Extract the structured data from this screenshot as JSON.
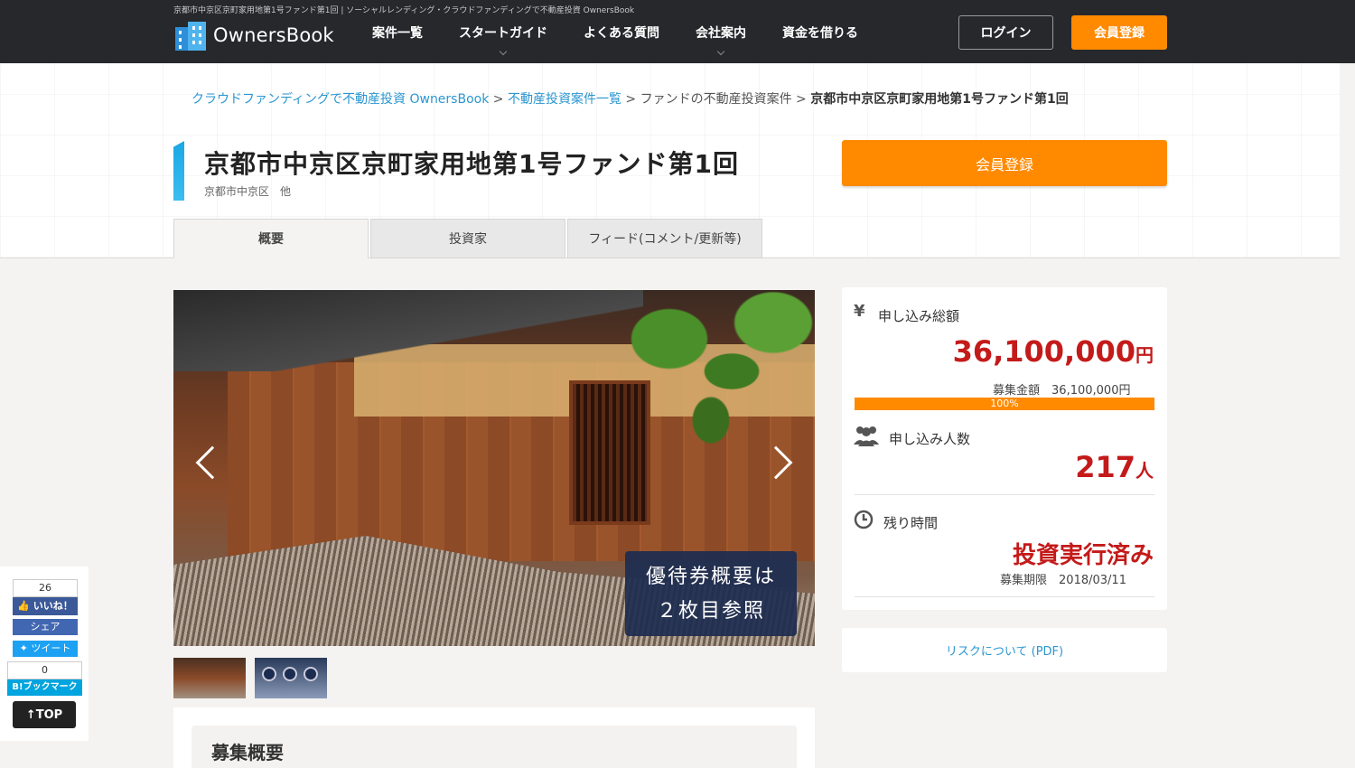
{
  "header": {
    "tagline": "京都市中京区京町家用地第1号ファンド第1回 | ソーシャルレンディング・クラウドファンディングで不動産投資 OwnersBook",
    "logo_text": "OwnersBook",
    "nav": [
      {
        "label": "案件一覧"
      },
      {
        "label": "スタートガイド"
      },
      {
        "label": "よくある質問"
      },
      {
        "label": "会社案内"
      },
      {
        "label": "資金を借りる"
      }
    ],
    "login_label": "ログイン",
    "register_label": "会員登録"
  },
  "breadcrumb": {
    "item1": "クラウドファンディングで不動産投資 OwnersBook",
    "sep": " > ",
    "item2": "不動産投資案件一覧",
    "item3": "ファンドの不動産投資案件",
    "current": "京都市中京区京町家用地第1号ファンド第1回"
  },
  "page": {
    "title": "京都市中京区京町家用地第1号ファンド第1回",
    "subtitle": "京都市中京区　他",
    "register_label": "会員登録"
  },
  "tabs": [
    {
      "label": "概要"
    },
    {
      "label": "投資家"
    },
    {
      "label": "フィード(コメント/更新等)"
    }
  ],
  "hero": {
    "caption_line1": "優待券概要は",
    "caption_line2": "２枚目参照"
  },
  "overview": {
    "title": "募集概要"
  },
  "stats": {
    "amount_icon": "¥",
    "amount_label": "申し込み総額",
    "amount_value": "36,100,000",
    "amount_unit": "円",
    "target_label": "募集金額",
    "target_value": "36,100,000円",
    "progress_percent_text": "100%",
    "progress_fraction": 1.0,
    "people_label": "申し込み人数",
    "people_value": "217",
    "people_unit": "人",
    "time_label": "残り時間",
    "time_value": "投資実行済み",
    "deadline_label": "募集期限",
    "deadline_value": "2018/03/11"
  },
  "risk_link": "リスクについて (PDF)",
  "social": {
    "like_count": "26",
    "like_label": "いいね！",
    "share_label": "シェア",
    "tweet_label": "ツイート",
    "hatena_count": "0",
    "hatena_label": "B!ブックマーク",
    "top_label": "↑TOP"
  },
  "colors": {
    "header_bg": "#26282c",
    "accent_orange": "#ff8a00",
    "link_blue": "#2b96d0",
    "value_red": "#c41a1a"
  }
}
